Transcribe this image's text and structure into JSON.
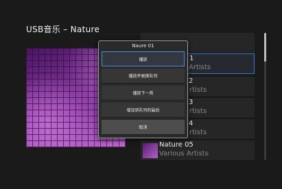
{
  "header": {
    "title": "USB音乐 – Nature"
  },
  "tracks": [
    {
      "title": "",
      "artist": ""
    },
    {
      "title": "1",
      "artist": "Artists"
    },
    {
      "title": "2",
      "artist": "rtists"
    },
    {
      "title": "3",
      "artist": "rtists"
    },
    {
      "title": "4",
      "artist": "rtists"
    },
    {
      "title": "Nature 05",
      "artist": "Various Artists"
    }
  ],
  "popup": {
    "title": "Naure 01",
    "options": [
      {
        "label": "播放"
      },
      {
        "label": "播放并更换队列"
      },
      {
        "label": "播放下一首"
      },
      {
        "label": "增加到队列的最后"
      },
      {
        "label": "取消"
      }
    ]
  },
  "colors": {
    "accent": "#3b7bc6",
    "background": "#1a1a1a"
  }
}
